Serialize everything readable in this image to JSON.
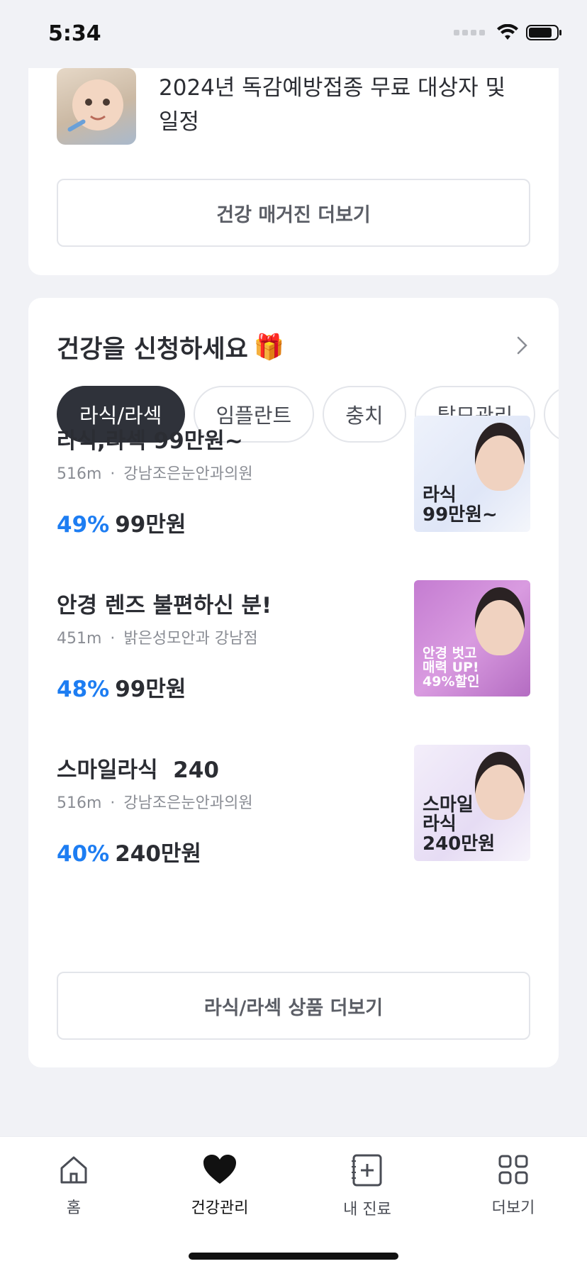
{
  "status_bar": {
    "time": "5:34"
  },
  "magazine": {
    "article_title": "2024년 독감예방접종 무료 대상자 및 일정",
    "more_label": "건강 매거진 더보기"
  },
  "section": {
    "title": "건강을 신청하세요",
    "emoji": "🎁",
    "chips": [
      "라식/라섹",
      "임플란트",
      "충치",
      "탈모관리",
      ""
    ],
    "active_chip": "라식/라섹",
    "products": [
      {
        "title": "라식,라섹 99만원~",
        "distance": "516m",
        "clinic": "강남조은눈안과의원",
        "discount": "49%",
        "price": "99만원",
        "image_text": "라식\n99만원~"
      },
      {
        "title": "안경 렌즈 불편하신 분!",
        "distance": "451m",
        "clinic": "밝은성모안과 강남점",
        "discount": "48%",
        "price": "99만원",
        "image_text": "안경 벗고\n매력 UP!\n49%할인"
      },
      {
        "title": "스마일라식  240",
        "distance": "516m",
        "clinic": "강남조은눈안과의원",
        "discount": "40%",
        "price": "240만원",
        "image_text": "스마일\n라식\n240만원"
      }
    ],
    "more_label": "라식/라섹 상품 더보기"
  },
  "tabbar": {
    "items": [
      {
        "label": "홈",
        "icon": "home-icon"
      },
      {
        "label": "건강관리",
        "icon": "heart-icon"
      },
      {
        "label": "내 진료",
        "icon": "medical-note-icon"
      },
      {
        "label": "더보기",
        "icon": "grid-icon"
      }
    ],
    "active_index": 1
  },
  "colors": {
    "accent_blue": "#1d7df2",
    "chip_active_bg": "#2f323a",
    "page_bg": "#f1f2f6"
  }
}
